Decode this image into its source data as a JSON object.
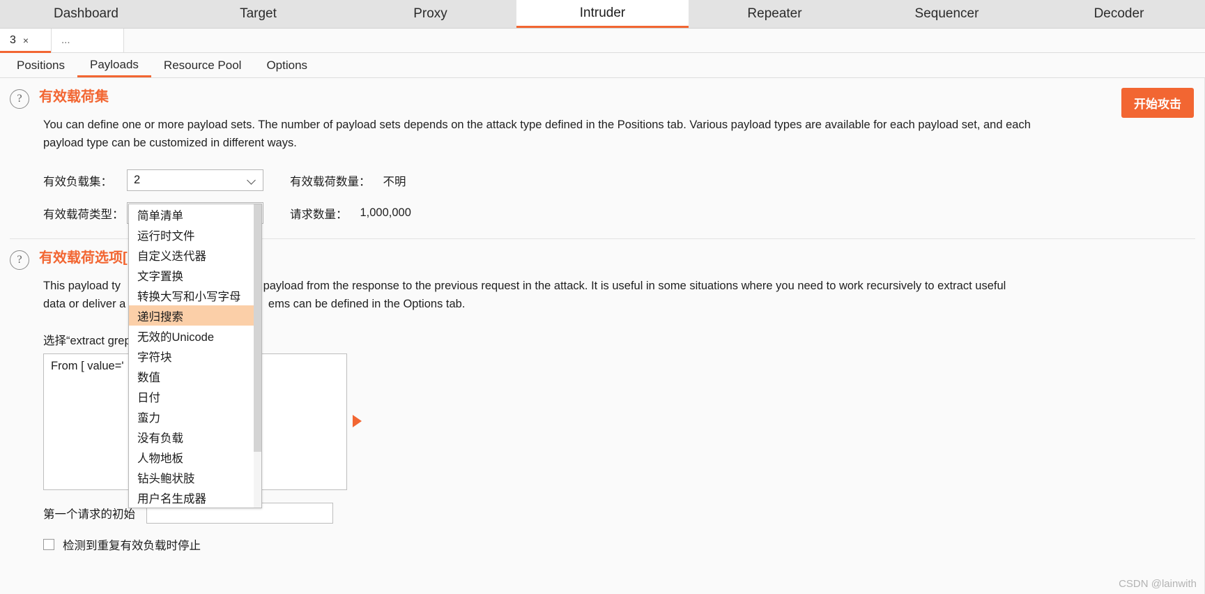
{
  "main_tabs": [
    {
      "label": "Dashboard",
      "active": false
    },
    {
      "label": "Target",
      "active": false
    },
    {
      "label": "Proxy",
      "active": false
    },
    {
      "label": "Intruder",
      "active": true
    },
    {
      "label": "Repeater",
      "active": false
    },
    {
      "label": "Sequencer",
      "active": false
    },
    {
      "label": "Decoder",
      "active": false
    }
  ],
  "attack_tabs": {
    "tab_label": "3",
    "close_label": "×",
    "more_label": "..."
  },
  "sub_tabs": [
    {
      "label": "Positions",
      "active": false
    },
    {
      "label": "Payloads",
      "active": true
    },
    {
      "label": "Resource Pool",
      "active": false
    },
    {
      "label": "Options",
      "active": false
    }
  ],
  "start_attack_button": "开始攻击",
  "payload_sets": {
    "help_icon": "question-mark-icon",
    "title": "有效载荷集",
    "description": "You can define one or more payload sets. The number of payload sets depends on the attack type defined in the Positions tab. Various payload types are available for each payload set, and each payload type can be customized in different ways.",
    "rows": [
      {
        "label": "有效负载集：",
        "select_value": "2",
        "side_label": "有效载荷数量：",
        "side_value": "不明"
      },
      {
        "label": "有效载荷类型：",
        "select_value": "递归搜索",
        "side_label": "请求数量：",
        "side_value": "1,000,000"
      }
    ]
  },
  "payload_type_dropdown": {
    "selected": "递归搜索",
    "options": [
      "简单清单",
      "运行时文件",
      "自定义迭代器",
      "文字置换",
      "转换大写和小写字母",
      "递归搜索",
      "无效的Unicode",
      "字符块",
      "数值",
      "日付",
      "蛮力",
      "没有负载",
      "人物地板",
      "钻头鲍状肢",
      "用户名生成器"
    ]
  },
  "payload_options": {
    "help_icon": "question-mark-icon",
    "title": "有效载荷选项[",
    "description_line1": "This payload ty",
    "description_line1_right": "payload from the response to the previous request in the attack. It is useful in some situations where you need to work recursively to extract useful",
    "description_line2": "data or deliver a",
    "description_line2_right": "ems can be defined in the Options tab.",
    "grep_label": "选择“extract grep",
    "textarea_value": "From [ value='",
    "play_icon": "play-arrow-icon",
    "initial_label": "第一个请求的初始",
    "initial_value": "",
    "checkbox_label": "检测到重复有效负载时停止",
    "checkbox_checked": false
  },
  "watermark": "CSDN @lainwith",
  "colors": {
    "accent": "#f26632",
    "highlight": "#fbcfa8",
    "tabbar_bg": "#e3e3e3",
    "page_bg": "#fafafa"
  }
}
